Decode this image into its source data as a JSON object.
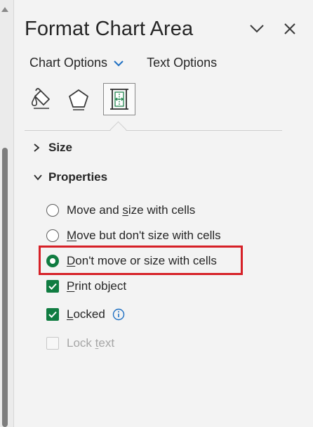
{
  "pane": {
    "title": "Format Chart Area",
    "collapse_icon": "chevron-down-icon",
    "close_icon": "close-icon"
  },
  "tabs": [
    {
      "label": "Chart Options",
      "has_dropdown": true,
      "selected": true
    },
    {
      "label": "Text Options",
      "has_dropdown": false,
      "selected": false
    }
  ],
  "icon_tabs": [
    {
      "icon": "fill-line-icon",
      "selected": false
    },
    {
      "icon": "effects-pentagon-icon",
      "selected": false
    },
    {
      "icon": "size-properties-icon",
      "selected": true
    }
  ],
  "sections": {
    "size": {
      "label": "Size",
      "expanded": false
    },
    "properties": {
      "label": "Properties",
      "expanded": true
    }
  },
  "options": {
    "move_and_size": {
      "pre": "Move and ",
      "mnemonic": "s",
      "post": "ize with cells",
      "checked": false
    },
    "move_no_size": {
      "pre": "",
      "mnemonic": "M",
      "post": "ove but don't size with cells",
      "checked": false
    },
    "dont_move": {
      "pre": "",
      "mnemonic": "D",
      "post": "on't move or size with cells",
      "checked": true
    },
    "print_object": {
      "pre": "",
      "mnemonic": "P",
      "post": "rint object",
      "checked": true
    },
    "locked": {
      "pre": "",
      "mnemonic": "L",
      "post": "ocked",
      "checked": true,
      "info_icon": "info-icon"
    },
    "lock_text": {
      "pre": "Lock ",
      "mnemonic": "t",
      "post": "ext",
      "checked": false,
      "disabled": true
    }
  },
  "colors": {
    "accent": "#107c41",
    "highlight": "#d62027",
    "background": "#f3f3f3",
    "info": "#1e6fc2"
  }
}
